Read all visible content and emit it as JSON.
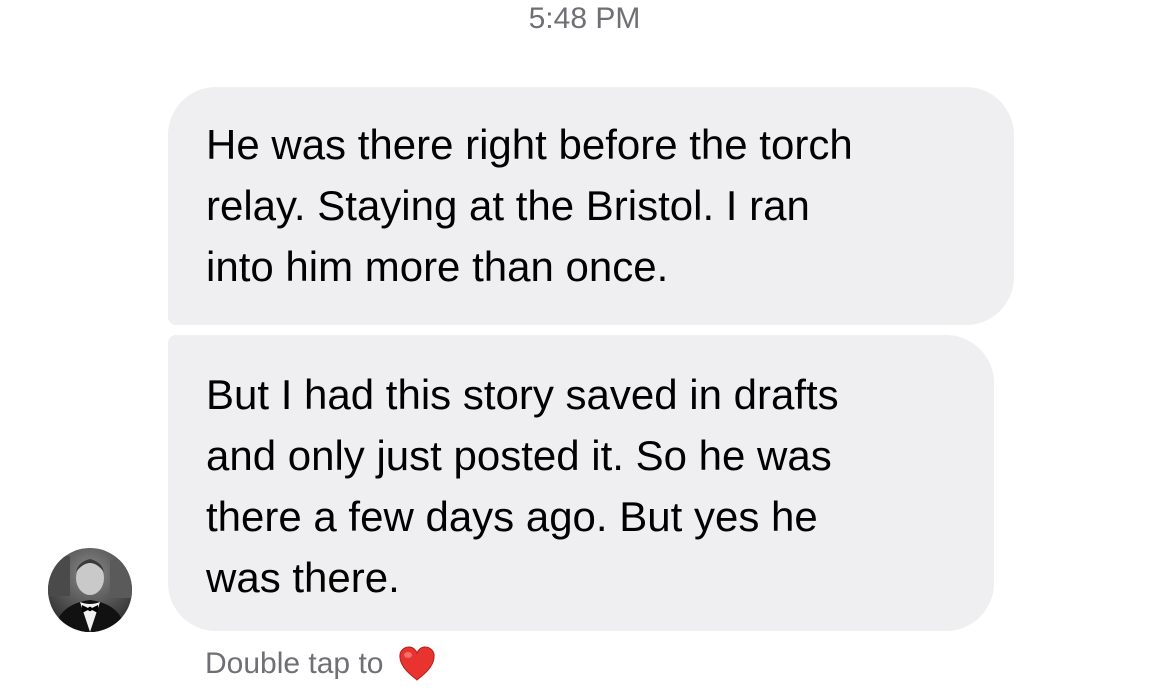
{
  "thread": {
    "timestamp": "5:48 PM",
    "messages": [
      {
        "lines": [
          "He was there right before the torch",
          "relay. Staying at the Bristol. I ran",
          "into him more than once."
        ]
      },
      {
        "lines": [
          "But I had this story saved in drafts",
          "and only just posted it. So he was",
          "there a few days ago. But yes he",
          "was there."
        ]
      }
    ],
    "reaction_hint": "Double tap to",
    "reaction_icon": "heart-icon",
    "sender_avatar": "avatar"
  },
  "colors": {
    "bubble": "#efeff1",
    "meta_text": "#6f6f74",
    "heart": "#e8332f"
  }
}
